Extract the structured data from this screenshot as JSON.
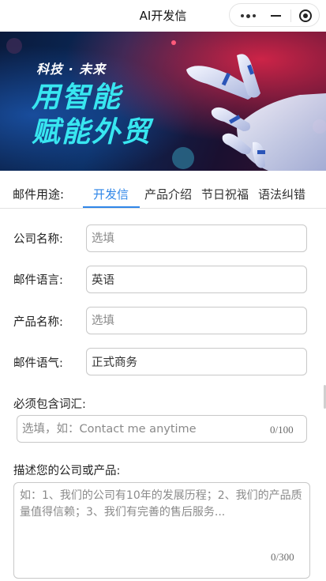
{
  "window": {
    "title": "AI开发信"
  },
  "capsule": {
    "more_icon": "more-dots-icon",
    "minimize_icon": "minus-icon",
    "close_icon": "target-circle-icon"
  },
  "banner": {
    "tagline": "科技 · 未来",
    "headline_line1": "用智能",
    "headline_line2": "赋能外贸",
    "accent_color": "#38e6f0"
  },
  "tabs": {
    "label": "邮件用途:",
    "items": [
      {
        "label": "开发信",
        "active": true
      },
      {
        "label": "产品介绍",
        "active": false
      },
      {
        "label": "节日祝福",
        "active": false
      },
      {
        "label": "语法纠错",
        "active": false
      }
    ],
    "active_color": "#2f86e8"
  },
  "form": {
    "company_name": {
      "label": "公司名称:",
      "placeholder": "选填"
    },
    "email_language": {
      "label": "邮件语言:",
      "value": "英语"
    },
    "product_name": {
      "label": "产品名称:",
      "placeholder": "选填"
    },
    "email_tone": {
      "label": "邮件语气:",
      "value": "正式商务"
    },
    "keywords": {
      "label": "必须包含词汇:",
      "placeholder": "选填，如：Contact me anytime",
      "counter": "0/100"
    },
    "description": {
      "label": "描述您的公司或产品:",
      "placeholder": "如：1、我们的公司有10年的发展历程；2、我们的产品质量值得信赖；3、我们有完善的售后服务...",
      "counter": "0/300"
    }
  }
}
